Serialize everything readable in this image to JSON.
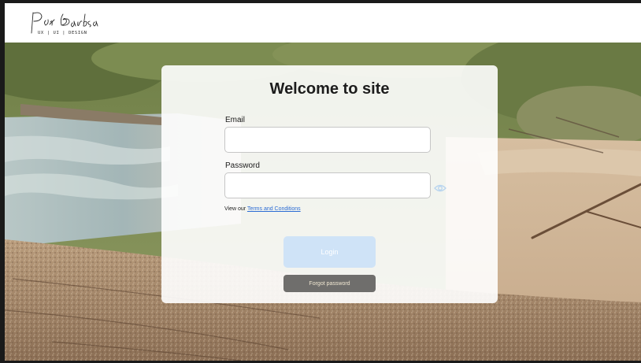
{
  "app": {
    "logo_text": "Pete Barbosa UX | UI | DESIGN"
  },
  "login": {
    "title": "Welcome to site",
    "email_label": "Email",
    "email_value": "",
    "password_label": "Password",
    "password_value": "",
    "terms_prefix": "View our ",
    "terms_link": "Terms and Conditions",
    "login_button": "Login",
    "forgot_button": "Forgot password"
  },
  "icons": {
    "logo": "signature-logo",
    "password_toggle": "eye-icon"
  },
  "colors": {
    "login_button_bg": "#cfe3f7",
    "forgot_button_bg": "#6f6e6c",
    "forgot_button_text": "#f0e7d2",
    "link": "#2b6cd4",
    "eye_icon": "#b8d4ef"
  }
}
